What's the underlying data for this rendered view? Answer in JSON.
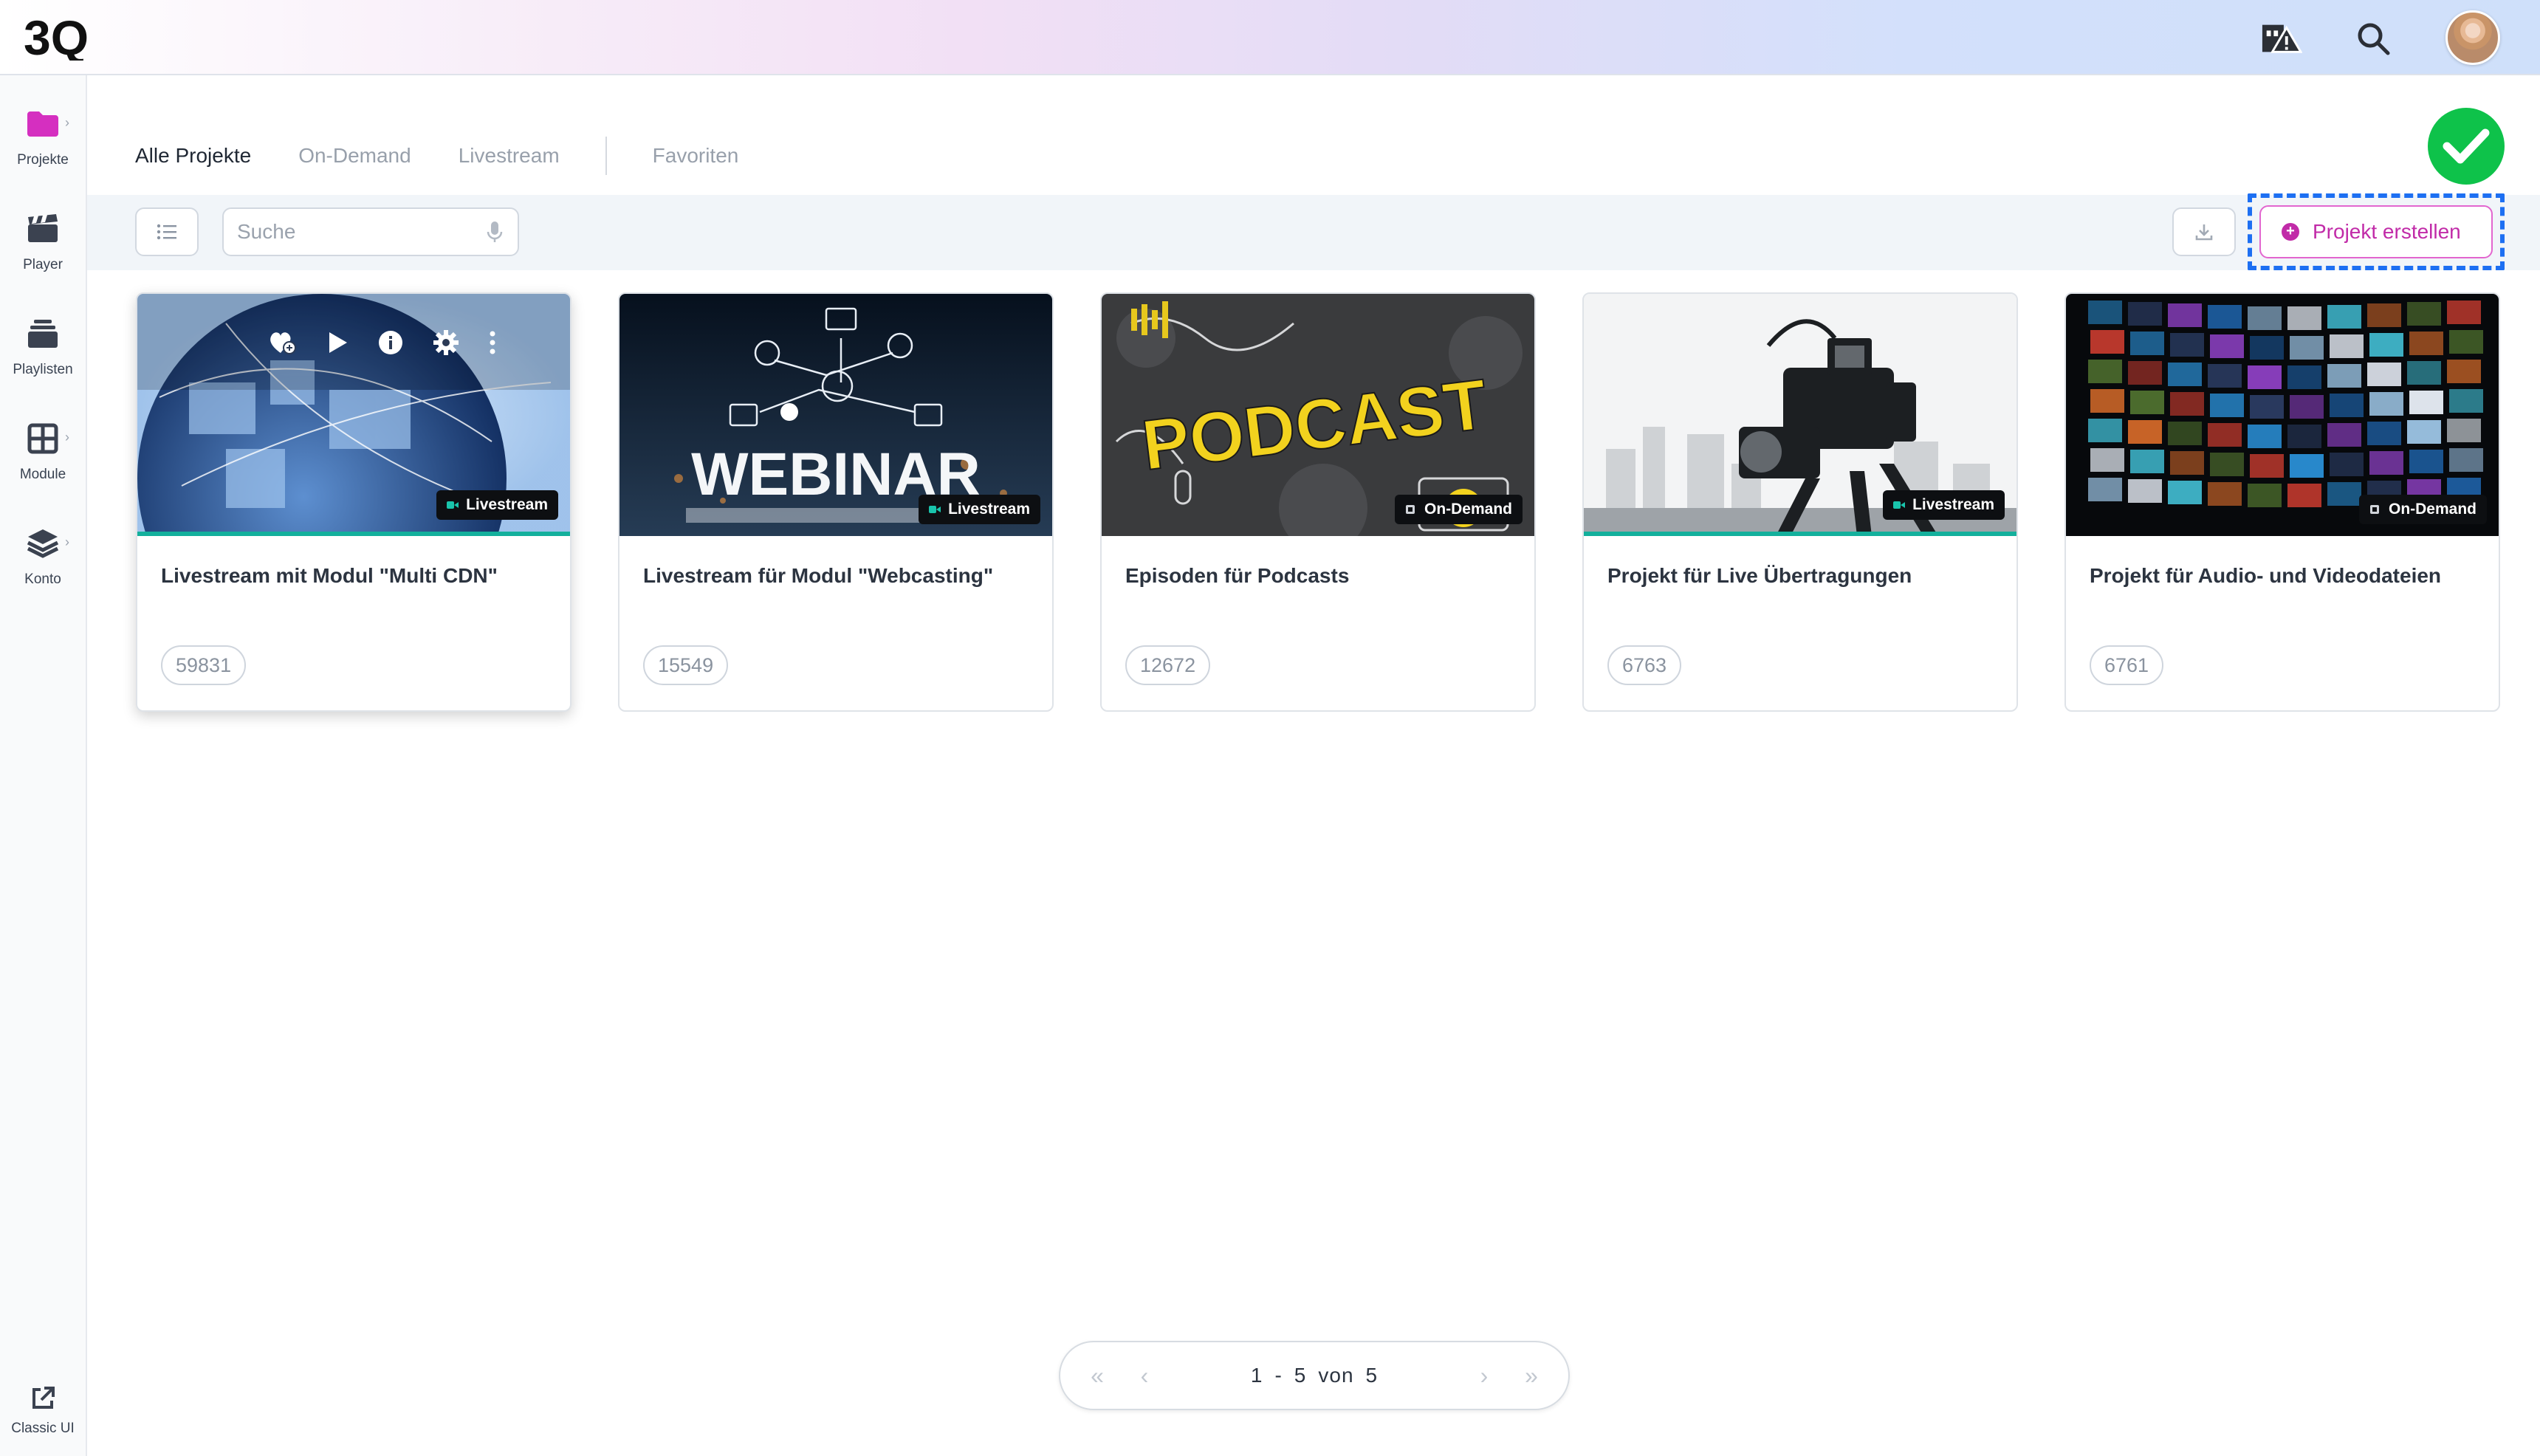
{
  "app": {
    "logo_text": "3Q"
  },
  "sidebar": {
    "items": [
      {
        "label": "Projekte",
        "icon": "folder-icon"
      },
      {
        "label": "Player",
        "icon": "clapperboard-icon"
      },
      {
        "label": "Playlisten",
        "icon": "stack-icon"
      },
      {
        "label": "Module",
        "icon": "grid-icon"
      },
      {
        "label": "Konto",
        "icon": "layers-icon"
      }
    ],
    "classic": {
      "label": "Classic UI",
      "icon": "external-link-icon"
    }
  },
  "tabs": [
    "Alle Projekte",
    "On-Demand",
    "Livestream",
    "Favoriten"
  ],
  "toolbar": {
    "search_placeholder": "Suche",
    "create_label": "Projekt erstellen"
  },
  "colors": {
    "accent_magenta": "#c12ba8",
    "livestream_accent": "#13b09c",
    "focus_blue": "#1d6ff2",
    "success_green": "#0ec24a"
  },
  "cards": [
    {
      "title": "Livestream mit Modul \"Multi CDN\"",
      "id": "59831",
      "badge": "Livestream",
      "thumb": "globe-network-image"
    },
    {
      "title": "Livestream für Modul \"Webcasting\"",
      "id": "15549",
      "badge": "Livestream",
      "thumb_text": "WEBINAR"
    },
    {
      "title": "Episoden für Podcasts",
      "id": "12672",
      "badge": "On-Demand",
      "thumb_text": "PODCAST"
    },
    {
      "title": "Projekt für Live Übertragungen",
      "id": "6763",
      "badge": "Livestream",
      "thumb": "tv-camera-image"
    },
    {
      "title": "Projekt für Audio- und Videodateien",
      "id": "6761",
      "badge": "On-Demand",
      "thumb": "video-wall-image"
    }
  ],
  "pagination": {
    "from": "1",
    "dash": "-",
    "to": "5",
    "of_label": "von",
    "total": "5"
  }
}
